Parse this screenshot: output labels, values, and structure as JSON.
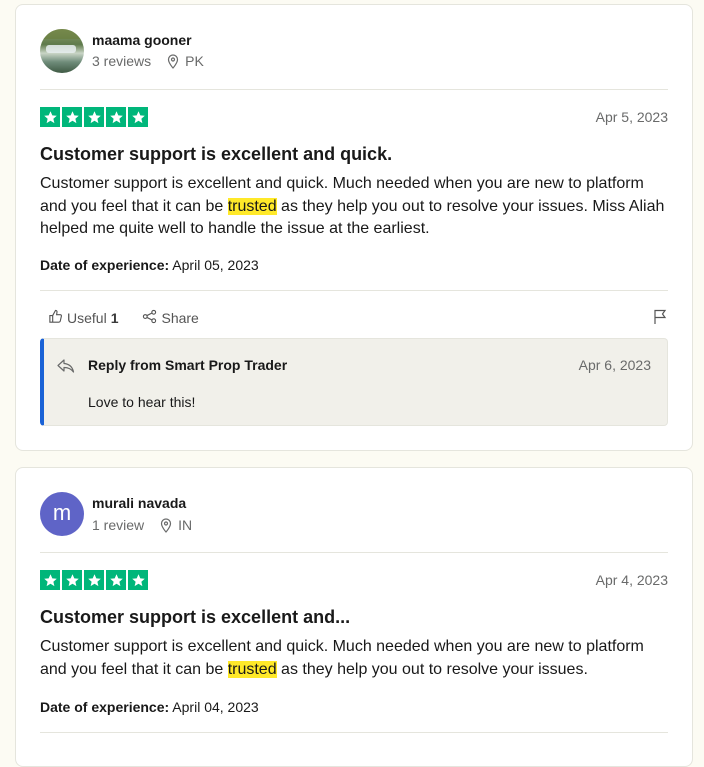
{
  "reviews": [
    {
      "reviewer": {
        "name": "maama gooner",
        "reviews": "3 reviews",
        "country": "PK"
      },
      "rating": 5,
      "date": "Apr 5, 2023",
      "title": "Customer support is excellent and quick.",
      "body_pre": "Customer support is excellent and quick. Much needed when you are new to platform and you feel that it can be ",
      "body_highlight": "trusted",
      "body_post": " as they help you out to resolve your issues. Miss Aliah helped me quite well to handle the issue at the earliest.",
      "experience_label": "Date of experience:",
      "experience_date": "April 05, 2023",
      "useful_label": "Useful",
      "useful_count": "1",
      "share_label": "Share",
      "reply": {
        "title": "Reply from Smart Prop Trader",
        "date": "Apr 6, 2023",
        "text": "Love to hear this!"
      }
    },
    {
      "reviewer": {
        "name": "murali navada",
        "initial": "m",
        "reviews": "1 review",
        "country": "IN"
      },
      "rating": 5,
      "date": "Apr 4, 2023",
      "title": "Customer support is excellent and...",
      "body_pre": "Customer support is excellent and quick. Much needed when you are new to platform and you feel that it can be ",
      "body_highlight": "trusted",
      "body_post": " as they help you out to resolve your issues.",
      "experience_label": "Date of experience:",
      "experience_date": "April 04, 2023"
    }
  ],
  "colors": {
    "star_green": "#00b67a",
    "highlight": "#ffe929",
    "reply_accent": "#1a62d6",
    "avatar_purple": "#5f64c7"
  }
}
